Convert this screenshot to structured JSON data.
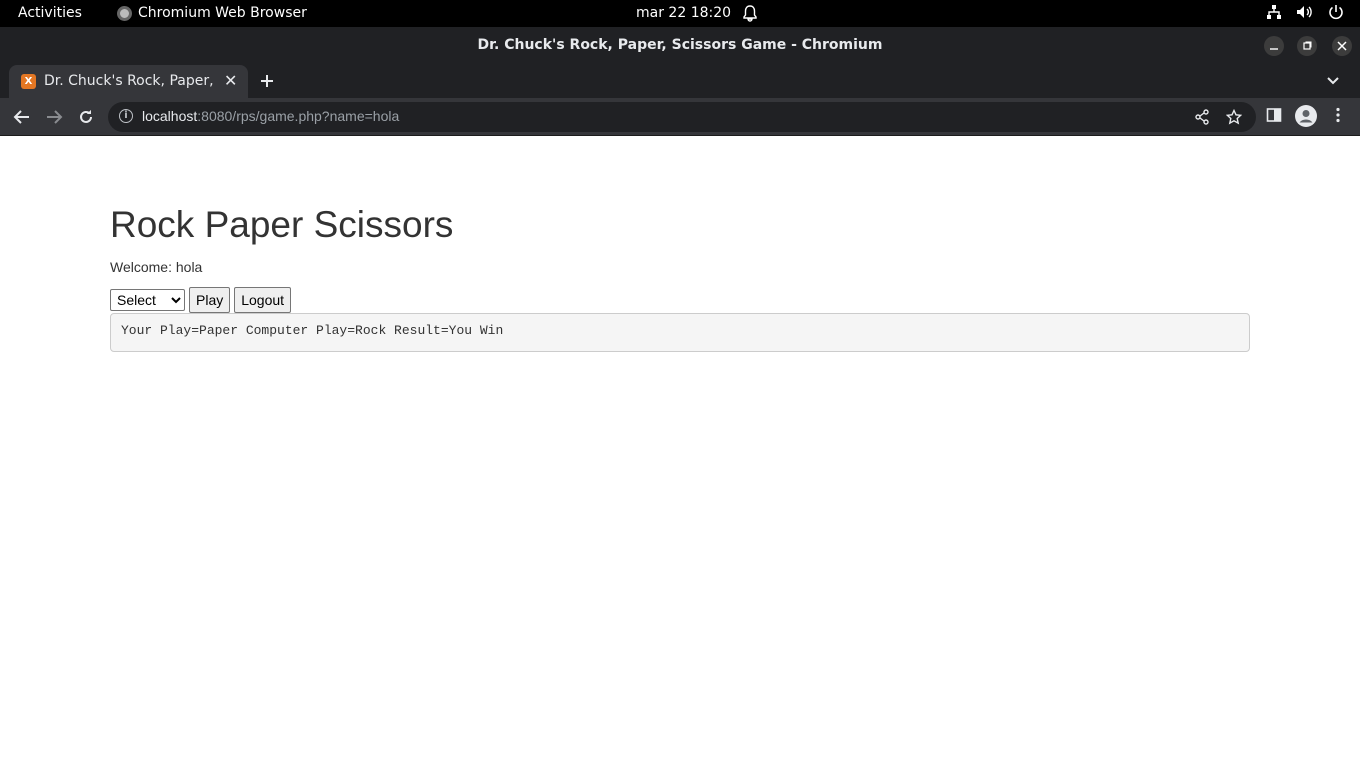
{
  "system_bar": {
    "activities": "Activities",
    "app_name": "Chromium Web Browser",
    "clock": "mar 22  18:20"
  },
  "window": {
    "title": "Dr. Chuck's Rock, Paper, Scissors Game - Chromium"
  },
  "tabs": [
    {
      "label": "Dr. Chuck's Rock, Paper, Scissors Game - Chromium",
      "active": true
    }
  ],
  "address_bar": {
    "host": "localhost",
    "path": ":8080/rps/game.php?name=hola"
  },
  "page": {
    "heading": "Rock Paper Scissors",
    "welcome": "Welcome: hola",
    "select_value": "Select",
    "play_label": "Play",
    "logout_label": "Logout",
    "result": "Your Play=Paper Computer Play=Rock Result=You Win"
  }
}
